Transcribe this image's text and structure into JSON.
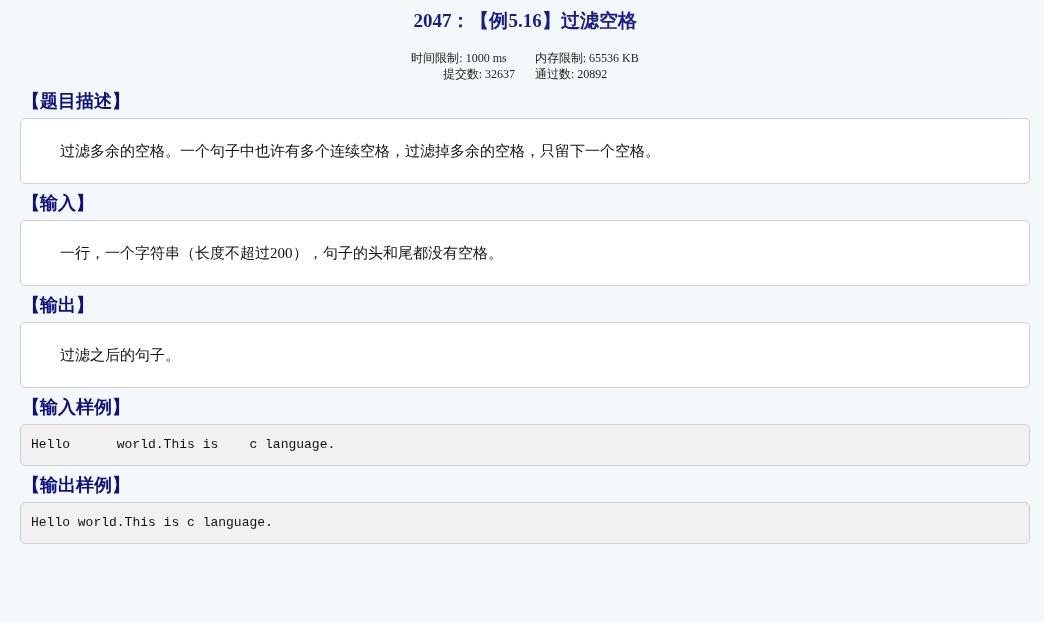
{
  "title": "2047：【例5.16】过滤空格",
  "limits": [
    {
      "label": "时间限制: 1000 ms"
    },
    {
      "label": "内存限制: 65536 KB"
    }
  ],
  "stats": [
    {
      "label": "提交数: 32637"
    },
    {
      "label": "通过数: 20892"
    }
  ],
  "sections": [
    {
      "heading": "【题目描述】",
      "kind": "text",
      "body": "过滤多余的空格。一个句子中也许有多个连续空格，过滤掉多余的空格，只留下一个空格。"
    },
    {
      "heading": "【输入】",
      "kind": "text",
      "body": "一行，一个字符串（长度不超过200），句子的头和尾都没有空格。"
    },
    {
      "heading": "【输出】",
      "kind": "text",
      "body": "过滤之后的句子。"
    },
    {
      "heading": "【输入样例】",
      "kind": "code",
      "body": "Hello      world.This is    c language."
    },
    {
      "heading": "【输出样例】",
      "kind": "code",
      "body": "Hello world.This is c language."
    }
  ]
}
